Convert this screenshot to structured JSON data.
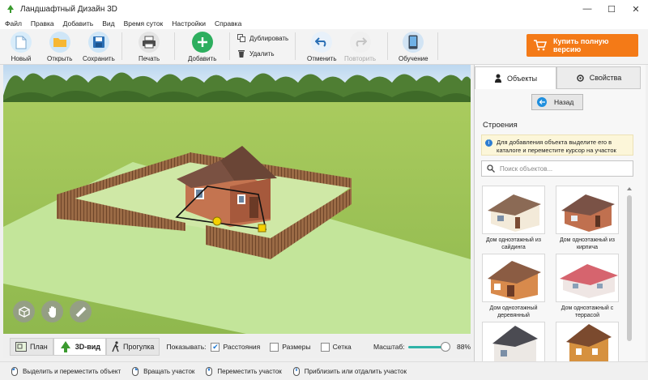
{
  "window": {
    "title": "Ландшафтный Дизайн 3D",
    "minimize": "—",
    "maximize": "☐",
    "close": "✕"
  },
  "menu": [
    "Файл",
    "Правка",
    "Добавить",
    "Вид",
    "Время суток",
    "Настройки",
    "Справка"
  ],
  "toolbar": {
    "new": "Новый",
    "open": "Открыть",
    "save": "Сохранить",
    "print": "Печать",
    "add": "Добавить",
    "duplicate": "Дублировать",
    "delete": "Удалить",
    "undo": "Отменить",
    "redo": "Повторить",
    "learn": "Обучение",
    "buy": "Купить полную версию"
  },
  "bottombar": {
    "mode_plan": "План",
    "mode_3d": "3D-вид",
    "mode_walk": "Прогулка",
    "show_label": "Показывать:",
    "checks": [
      {
        "label": "Расстояния",
        "checked": true
      },
      {
        "label": "Размеры",
        "checked": false
      },
      {
        "label": "Сетка",
        "checked": false
      }
    ],
    "zoom_label": "Масштаб:",
    "zoom_value": "88%",
    "zoom_level": 0.88
  },
  "status": {
    "hint1": "Выделить и переместить объект",
    "hint2": "Вращать участок",
    "hint3": "Переместить участок",
    "hint4": "Приблизить или отдалить участок"
  },
  "panel": {
    "tab_objects": "Объекты",
    "tab_properties": "Свойства",
    "back": "Назад",
    "section": "Строения",
    "info": "Для добавления объекта выделите его в каталоге и переместите курсор на участок",
    "search_placeholder": "Поиск объектов...",
    "items": [
      {
        "caption": "Дом одноэтажный из сайдинга"
      },
      {
        "caption": "Дом одноэтажный из кирпича"
      },
      {
        "caption": "Дом одноэтажный деревянный"
      },
      {
        "caption": "Дом одноэтажный с террасой"
      },
      {
        "caption": ""
      },
      {
        "caption": ""
      }
    ]
  },
  "colors": {
    "accent": "#f47a17",
    "selection": "#1a1a1a",
    "handle": "#f5d000",
    "grass": "#9bc25a",
    "sky": "#c9e0f2"
  }
}
